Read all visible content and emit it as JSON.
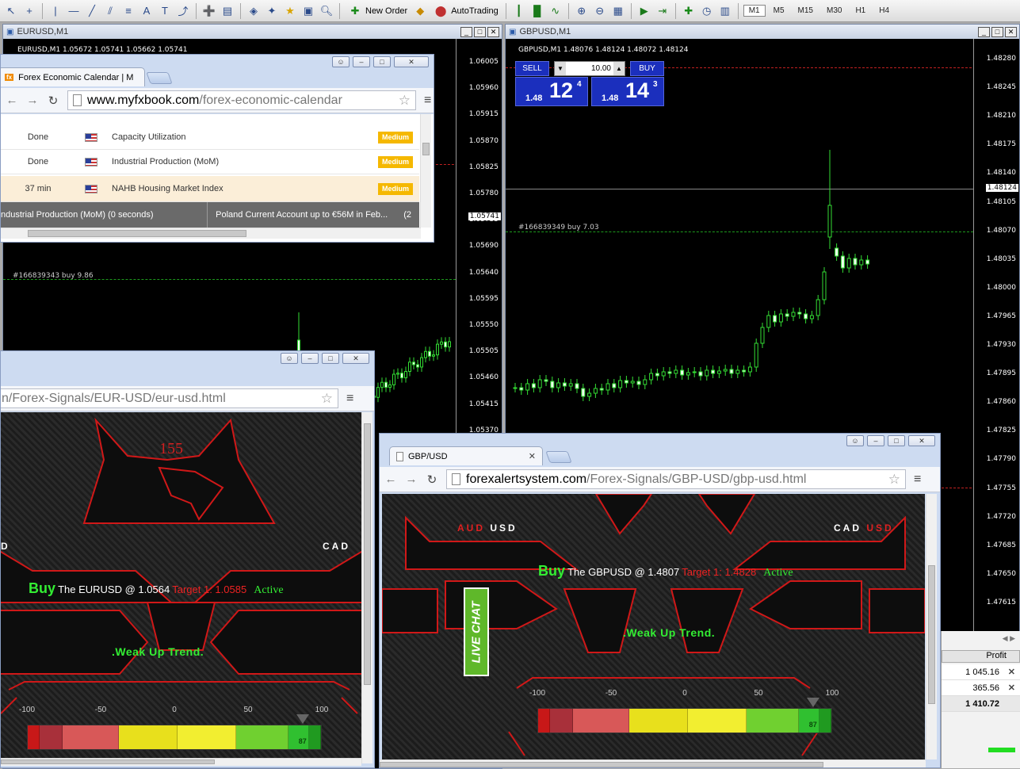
{
  "toolbar": {
    "new_order": "New Order",
    "autotrading": "AutoTrading",
    "timeframes": [
      "M1",
      "M5",
      "M15",
      "M30",
      "H1",
      "H4"
    ],
    "active_timeframe": "M1"
  },
  "eurusd_chart": {
    "title": "EURUSD,M1",
    "info": "EURUSD,M1  1.05672 1.05741 1.05662 1.05741",
    "order_label": "#166839343 buy 9.86",
    "current_price": "1.05741",
    "y_labels": [
      "1.06005",
      "1.05960",
      "1.05915",
      "1.05870",
      "1.05825",
      "1.05780",
      "1.05735",
      "1.05690",
      "1.05640",
      "1.05595",
      "1.05550",
      "1.05505",
      "1.05460",
      "1.05415",
      "1.05370"
    ]
  },
  "gbpusd_chart": {
    "title": "GBPUSD,M1",
    "info": "GBPUSD,M1  1.48076 1.48124 1.48072 1.48124",
    "order_label": "#166839349 buy 7.03",
    "current_price": "1.48124",
    "y_labels": [
      "1.48280",
      "1.48245",
      "1.48210",
      "1.48175",
      "1.48140",
      "1.48105",
      "1.48070",
      "1.48035",
      "1.48000",
      "1.47965",
      "1.47930",
      "1.47895",
      "1.47860",
      "1.47825",
      "1.47790",
      "1.47755",
      "1.47720",
      "1.47685",
      "1.47650",
      "1.47615"
    ],
    "one_click": {
      "sell": "SELL",
      "buy": "BUY",
      "volume": "10.00",
      "bid_small": "1.48",
      "bid_big": "12",
      "bid_sup": "4",
      "ask_small": "1.48",
      "ask_big": "14",
      "ask_sup": "3"
    }
  },
  "calendar_window": {
    "tab_title": "Forex Economic Calendar | M",
    "url_domain": "www.myfxbook.com",
    "url_path": "/forex-economic-calendar",
    "rows": [
      {
        "time": "Done",
        "event": "Capacity Utilization",
        "impact": "Medium"
      },
      {
        "time": "Done",
        "event": "Industrial Production (MoM)",
        "impact": "Medium"
      },
      {
        "time": "37 min",
        "event": "NAHB Housing Market Index",
        "impact": "Medium"
      }
    ],
    "ticker": [
      "ndustrial Production (MoM) (0 seconds)",
      "Poland Current Account up to €56M in Feb...",
      "(2"
    ]
  },
  "eurusd_signal_window": {
    "url_path": "n/Forex-Signals/EUR-USD/eur-usd.html",
    "counter": "155",
    "left_pair": "D",
    "right_pair": "CAD",
    "signal": {
      "action": "Buy",
      "text": "The EURUSD @ 1.0564",
      "target": "Target 1: 1.0585",
      "status": "Active"
    },
    "trend": ".Weak Up Trend.",
    "gauge": {
      "labels": [
        "-100",
        "-50",
        "0",
        "50",
        "100"
      ],
      "value": 87
    }
  },
  "gbpusd_signal_window": {
    "tab_title": "GBP/USD",
    "url_domain": "forexalertsystem.com",
    "url_path": "/Forex-Signals/GBP-USD/gbp-usd.html",
    "left_pair_a": "AUD",
    "left_pair_b": "USD",
    "right_pair_a": "CAD",
    "right_pair_b": "USD",
    "live_chat": "LIVE CHAT",
    "signal": {
      "action": "Buy",
      "text": "The GBPUSD @ 1.4807",
      "target": "Target 1: 1.4828",
      "status": "Active"
    },
    "trend": ".Weak Up Trend.",
    "gauge": {
      "labels": [
        "-100",
        "-50",
        "0",
        "50",
        "100"
      ],
      "value": 87
    }
  },
  "terminal": {
    "header": "Profit",
    "rows": [
      "1 045.16",
      "365.56"
    ],
    "total": "1 410.72"
  },
  "colors": {
    "buy_green": "#33ee33",
    "target_red": "#ee2222",
    "panel_blue": "#1b2fbd",
    "impact_orange": "#f5b800"
  }
}
